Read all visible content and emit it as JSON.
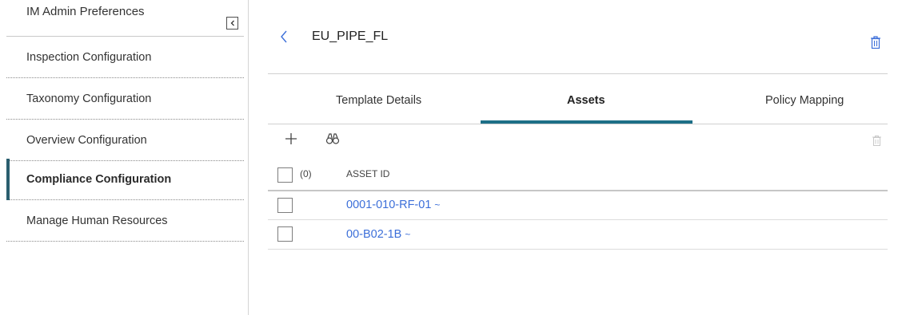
{
  "sidebar": {
    "title": "IM Admin Preferences",
    "collapse_icon": "chevron-left-icon",
    "items": [
      {
        "label": "Inspection Configuration",
        "active": false
      },
      {
        "label": "Taxonomy Configuration",
        "active": false
      },
      {
        "label": "Overview Configuration",
        "active": false
      },
      {
        "label": "Compliance Configuration",
        "active": true
      },
      {
        "label": "Manage Human Resources",
        "active": false
      }
    ]
  },
  "header": {
    "back_icon": "chevron-left-icon",
    "title": "EU_PIPE_FL",
    "delete_icon": "trash-icon"
  },
  "tabs": [
    {
      "label": "Template Details",
      "active": false
    },
    {
      "label": "Assets",
      "active": true
    },
    {
      "label": "Policy Mapping",
      "active": false
    }
  ],
  "toolbar": {
    "add_icon": "plus-icon",
    "search_icon": "binoculars-icon",
    "delete_icon": "trash-icon"
  },
  "table": {
    "selected_count": "(0)",
    "columns": [
      "ASSET ID"
    ],
    "rows": [
      {
        "asset_id": "0001-010-RF-01",
        "suffix": "~"
      },
      {
        "asset_id": "00-B02-1B",
        "suffix": "~"
      }
    ]
  },
  "colors": {
    "accent": "#1d6f87",
    "active_bar": "#2a5e6e",
    "link": "#3c6fd9"
  }
}
